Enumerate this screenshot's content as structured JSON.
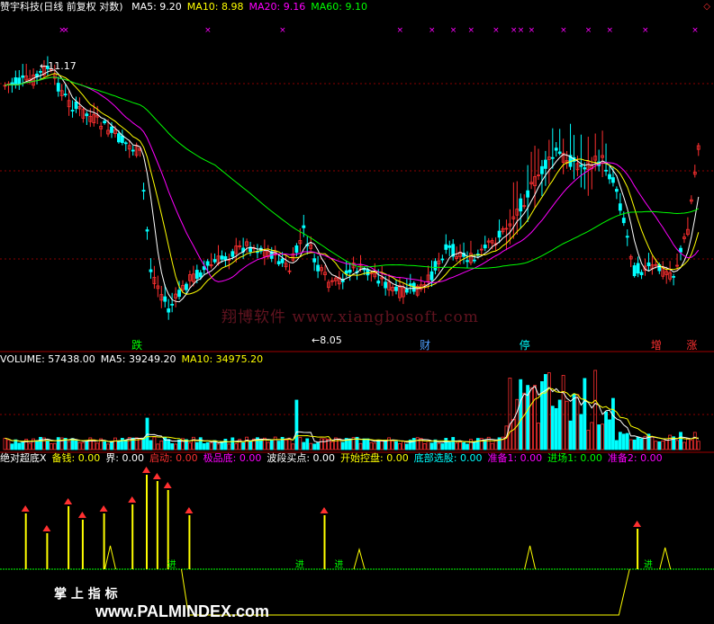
{
  "title": {
    "stock": "赞宇科技(日线 前复权 对数)",
    "ma": [
      {
        "label": "MA5: 9.20",
        "color": "#ffffff"
      },
      {
        "label": "MA10: 8.98",
        "color": "#ffff00"
      },
      {
        "label": "MA20: 9.16",
        "color": "#ff00ff"
      },
      {
        "label": "MA60: 9.10",
        "color": "#00ff00"
      }
    ]
  },
  "volume_header": [
    {
      "label": "VOLUME: 57438.00",
      "color": "#ffffff"
    },
    {
      "label": "MA5: 39249.20",
      "color": "#ffffff"
    },
    {
      "label": "MA10: 34975.20",
      "color": "#ffff00"
    }
  ],
  "indicator_header": [
    {
      "label": "绝对超底X",
      "color": "#ffffff"
    },
    {
      "label": "备钱: 0.00",
      "color": "#ffff00"
    },
    {
      "label": "界: 0.00",
      "color": "#ffffff"
    },
    {
      "label": "启动: 0.00",
      "color": "#ff3030"
    },
    {
      "label": "极品底: 0.00",
      "color": "#ff00ff"
    },
    {
      "label": "波段买点: 0.00",
      "color": "#ffffff"
    },
    {
      "label": "开始控盘: 0.00",
      "color": "#ffff00"
    },
    {
      "label": "底部选股: 0.00",
      "color": "#00ffff"
    },
    {
      "label": "准备1: 0.00",
      "color": "#ff00ff"
    },
    {
      "label": "进场1: 0.00",
      "color": "#00ff00"
    },
    {
      "label": "准备2: 0.00",
      "color": "#ff00ff"
    }
  ],
  "watermarks": {
    "main": "翔博软件 www.xiangbosoft.com",
    "bottom_left": "掌 上 指 标",
    "bottom": "www.PALMINDEX.com"
  },
  "colors": {
    "up": "#ff3030",
    "down": "#00ffff",
    "grid": "#8b0000",
    "ma5": "#ffffff",
    "ma10": "#ffff00",
    "ma20": "#ff00ff",
    "ma60": "#00ff00"
  },
  "chart_data": {
    "type": "candlestick",
    "price_annotations": {
      "high": "11.17",
      "low": "8.05"
    },
    "event_labels": [
      {
        "text": "跌",
        "bar": 37,
        "color": "#00ff00"
      },
      {
        "text": "财",
        "bar": 118,
        "color": "#4fa0ff"
      },
      {
        "text": "停",
        "bar": 146,
        "color": "#00ffff"
      },
      {
        "text": "增",
        "bar": 183,
        "color": "#ff3030"
      },
      {
        "text": "涨",
        "bar": 193,
        "color": "#ff3030"
      }
    ],
    "top_markers": [
      16,
      17,
      57,
      78,
      111,
      120,
      126,
      131,
      138,
      143,
      145,
      148,
      157,
      164,
      170,
      180,
      194
    ],
    "indicator_bottom_label": "进"
  }
}
